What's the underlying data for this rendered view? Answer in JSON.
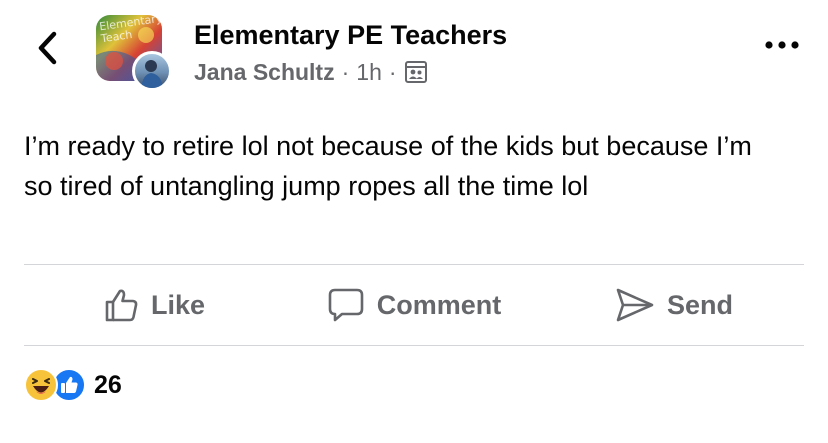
{
  "colors": {
    "text_primary": "#050505",
    "text_secondary": "#65676b",
    "divider": "#d3d5d9",
    "like_blue": "#1877f2",
    "haha_yellow": "#f7c33b"
  },
  "header": {
    "group_name": "Elementary PE Teachers",
    "author": "Jana Schultz",
    "separator": "·",
    "time": "1h",
    "audience_icon": "group-members-icon",
    "group_pic_text": "Elementary\nTeach"
  },
  "post": {
    "text": "I’m ready to retire lol not because of the kids but because I’m so tired of untangling jump ropes all the time lol"
  },
  "actions": {
    "like_label": "Like",
    "comment_label": "Comment",
    "send_label": "Send"
  },
  "reactions": {
    "types": [
      "haha",
      "like"
    ],
    "count": "26"
  }
}
